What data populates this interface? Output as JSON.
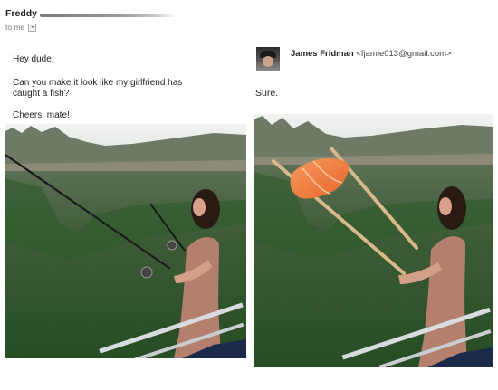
{
  "left_email": {
    "sender_name": "Freddy",
    "to_label": "to me",
    "greeting": "Hey dude,",
    "request_line1": "Can you make it look like my girlfriend has",
    "request_line2": "caught a fish?",
    "signoff": "Cheers, mate!"
  },
  "right_email": {
    "sender_name": "James Fridman",
    "sender_email": "<fjamie013@gmail.com>",
    "reply": "Sure."
  },
  "photos": {
    "original_description_icon": "photo-icon",
    "edited_description_icon": "photo-icon"
  },
  "colors": {
    "water": "#2f5a2c",
    "sky": "#e8ece9",
    "trees": "#6d7a62",
    "salmon": "#f07a3c",
    "dress": "#b57f6e",
    "rail": "#d7dadc"
  }
}
